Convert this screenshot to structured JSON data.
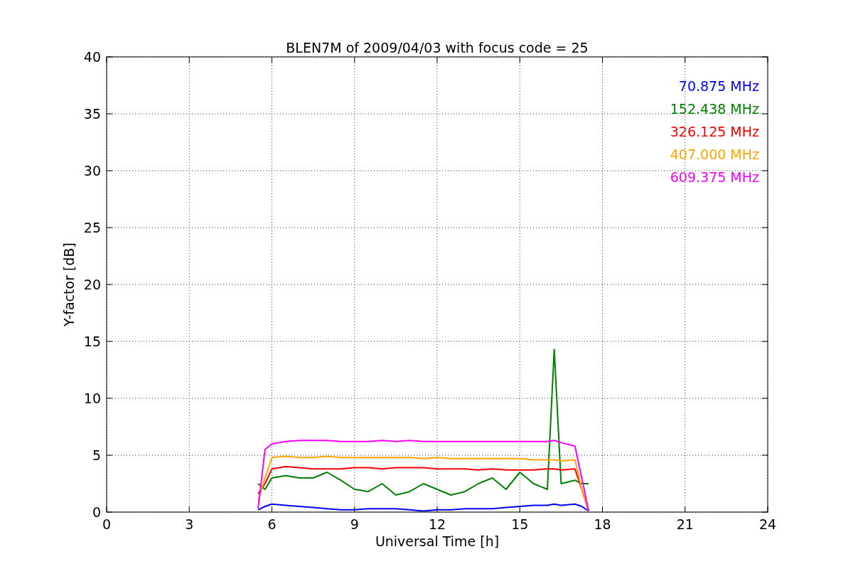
{
  "chart_data": {
    "type": "line",
    "title": "BLEN7M of 2009/04/03 with focus code = 25",
    "xlabel": "Universal Time [h]",
    "ylabel": "Y-factor [dB]",
    "x": [
      5.5,
      5.75,
      6,
      6.5,
      7,
      7.5,
      8,
      8.5,
      9,
      9.5,
      10,
      10.5,
      11,
      11.5,
      12,
      12.5,
      13,
      13.5,
      14,
      14.5,
      15,
      15.5,
      16,
      16.25,
      16.5,
      17,
      17.25,
      17.5
    ],
    "series": [
      {
        "name": "70.875 MHz",
        "color": "#0000ff",
        "values": [
          0.2,
          0.5,
          0.7,
          0.6,
          0.5,
          0.4,
          0.3,
          0.2,
          0.2,
          0.3,
          0.3,
          0.3,
          0.2,
          0.1,
          0.2,
          0.2,
          0.3,
          0.3,
          0.3,
          0.4,
          0.5,
          0.6,
          0.6,
          0.7,
          0.6,
          0.7,
          0.5,
          0.1
        ]
      },
      {
        "name": "152.438 MHz",
        "color": "#008000",
        "values": [
          2.5,
          2.0,
          3.0,
          3.2,
          3.0,
          3.0,
          3.5,
          2.8,
          2.0,
          1.8,
          2.5,
          1.5,
          1.8,
          2.5,
          2.0,
          1.5,
          1.8,
          2.5,
          3.0,
          2.0,
          3.5,
          2.5,
          2.0,
          14.3,
          2.5,
          2.8,
          2.5,
          2.5
        ]
      },
      {
        "name": "326.125 MHz",
        "color": "#ff0000",
        "values": [
          1.6,
          2.5,
          3.8,
          4.0,
          3.9,
          3.8,
          3.8,
          3.8,
          3.9,
          3.9,
          3.8,
          3.9,
          3.9,
          3.9,
          3.8,
          3.8,
          3.8,
          3.7,
          3.8,
          3.7,
          3.7,
          3.7,
          3.8,
          3.8,
          3.7,
          3.8,
          2.0,
          0.1
        ]
      },
      {
        "name": "407.000 MHz",
        "color": "#ffa500",
        "values": [
          1.0,
          3.0,
          4.8,
          4.9,
          4.8,
          4.8,
          4.9,
          4.8,
          4.8,
          4.8,
          4.8,
          4.8,
          4.8,
          4.7,
          4.8,
          4.7,
          4.7,
          4.7,
          4.7,
          4.7,
          4.7,
          4.6,
          4.6,
          4.6,
          4.5,
          4.6,
          2.0,
          0.1
        ]
      },
      {
        "name": "609.375 MHz",
        "color": "#ff00ff",
        "values": [
          0.3,
          5.5,
          6.0,
          6.2,
          6.3,
          6.3,
          6.3,
          6.2,
          6.2,
          6.2,
          6.3,
          6.2,
          6.3,
          6.2,
          6.2,
          6.2,
          6.2,
          6.2,
          6.2,
          6.2,
          6.2,
          6.2,
          6.2,
          6.3,
          6.1,
          5.8,
          3.0,
          0.1
        ]
      }
    ],
    "grid": true,
    "xlim": [
      0,
      24
    ],
    "ylim": [
      0,
      40
    ],
    "xticks": [
      0,
      3,
      6,
      9,
      12,
      15,
      18,
      21,
      24
    ],
    "yticks": [
      0,
      5,
      10,
      15,
      20,
      25,
      30,
      35,
      40
    ]
  }
}
